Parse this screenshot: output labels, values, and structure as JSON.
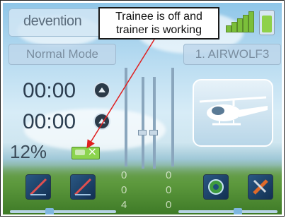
{
  "header": {
    "brand": "devention",
    "callout_line1": "Trainee is off and",
    "callout_line2": "trainer is working"
  },
  "status": {
    "mode": "Normal Mode",
    "model": "1. AIRWOLF3"
  },
  "timers": [
    {
      "value": "00:00"
    },
    {
      "value": "00:00"
    }
  ],
  "throttle_percent": "12%",
  "value_columns": {
    "left": [
      "0",
      "0",
      "4"
    ],
    "right": [
      "0",
      "0",
      "0"
    ]
  },
  "icons": {
    "brand": "devention-logo",
    "signal": "signal-icon",
    "battery": "battery-icon",
    "trainer": "trainer-switch-icon",
    "timer_button": "timer-up-icon",
    "heli": "helicopter-icon",
    "bottom_buttons": [
      "curve-left-icon",
      "curve-right-icon",
      "settings-icon",
      "tools-icon"
    ]
  },
  "colors": {
    "accent": "#7bbf3a",
    "callout_arrow": "#e02020"
  }
}
